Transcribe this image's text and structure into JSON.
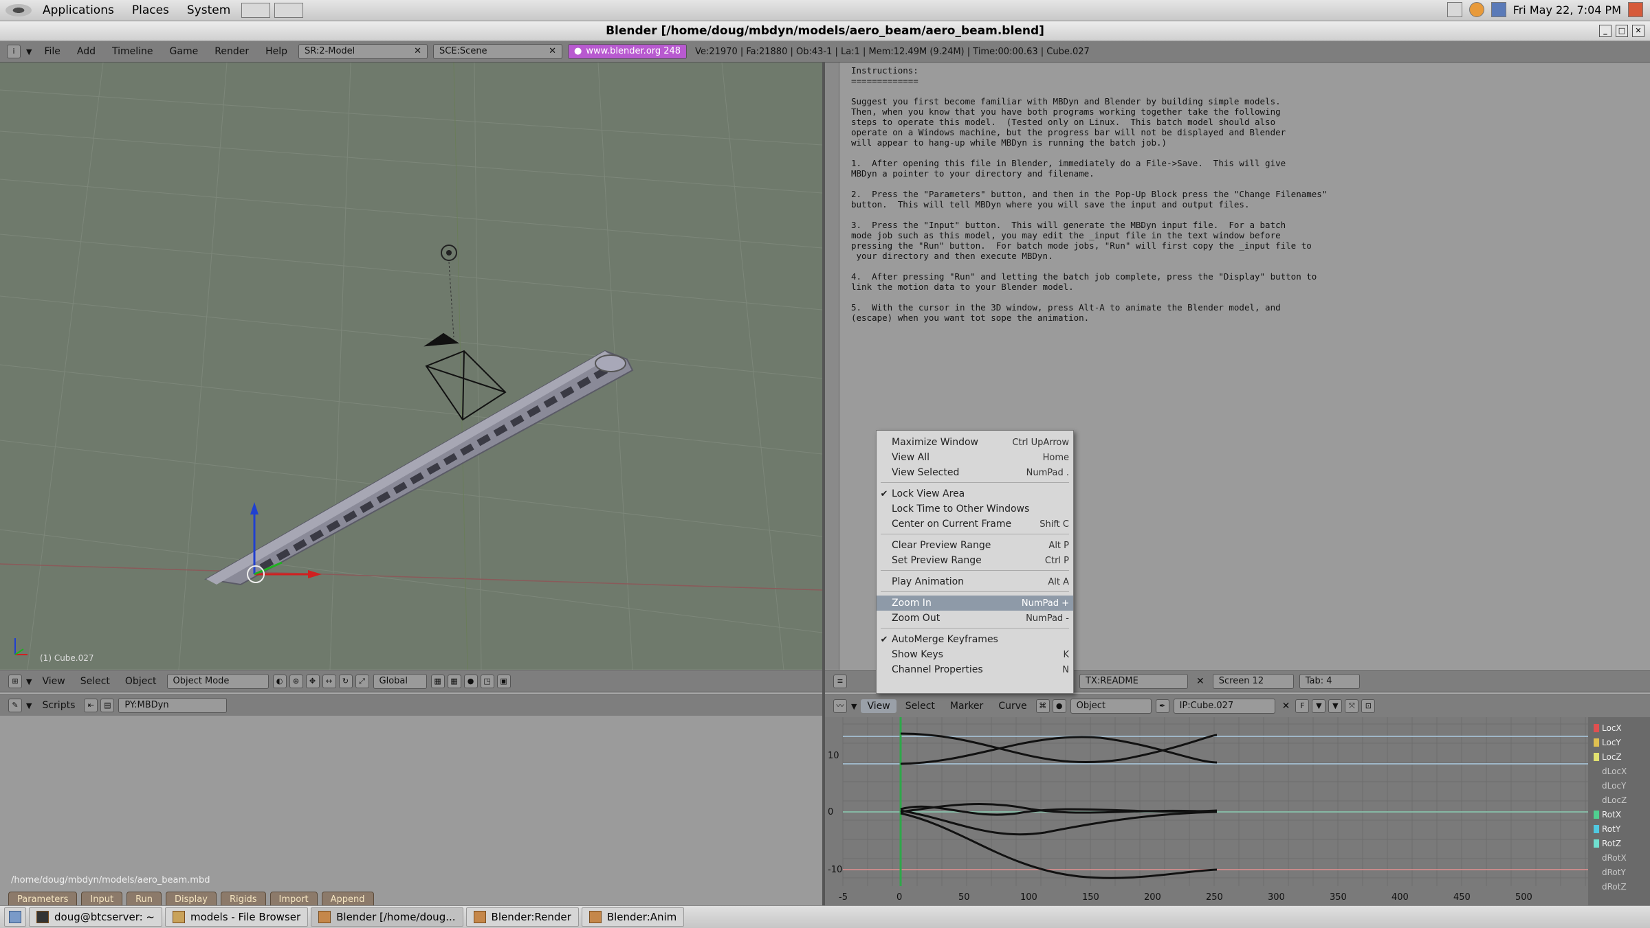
{
  "gnome_panel": {
    "menus": [
      "Applications",
      "Places",
      "System"
    ],
    "clock": "Fri May 22,  7:04 PM"
  },
  "window": {
    "title": "Blender [/home/doug/mbdyn/models/aero_beam/aero_beam.blend]"
  },
  "info_header": {
    "menus": [
      "File",
      "Add",
      "Timeline",
      "Game",
      "Render",
      "Help"
    ],
    "screen_field": "SR:2-Model",
    "scene_field": "SCE:Scene",
    "website": "www.blender.org 248",
    "stats": "Ve:21970 | Fa:21880 | Ob:43-1 | La:1  | Mem:12.49M (9.24M)  | Time:00:00.63 | Cube.027"
  },
  "viewport": {
    "caption": "(1) Cube.027",
    "header": {
      "menus": [
        "View",
        "Select",
        "Object"
      ],
      "mode": "Object Mode",
      "orientation": "Global"
    }
  },
  "text_editor": {
    "lines": [
      "Instructions:",
      "=============",
      "",
      "Suggest you first become familiar with MBDyn and Blender by building simple models.",
      "Then, when you know that you have both programs working together take the following",
      "steps to operate this model.  (Tested only on Linux.  This batch model should also",
      "operate on a Windows machine, but the progress bar will not be displayed and Blender",
      "will appear to hang-up while MBDyn is running the batch job.)",
      "",
      "1.  After opening this file in Blender, immediately do a File->Save.  This will give",
      "MBDyn a pointer to your directory and filename.",
      "",
      "2.  Press the \"Parameters\" button, and then in the Pop-Up Block press the \"Change Filenames\"",
      "button.  This will tell MBDyn where you will save the input and output files.",
      "",
      "3.  Press the \"Input\" button.  This will generate the MBDyn input file.  For a batch",
      "mode job such as this model, you may edit the _input file in the text window before",
      "pressing the \"Run\" button.  For batch mode jobs, \"Run\" will first copy the _input file to",
      " your directory and then execute MBDyn.",
      "",
      "4.  After pressing \"Run\" and letting the batch job complete, press the \"Display\" button to",
      "link the motion data to your Blender model.",
      "",
      "5.  With the cursor in the 3D window, press Alt-A to animate the Blender model, and",
      "(escape) when you want tot sope the animation."
    ],
    "header": {
      "text_name": "TX:README",
      "screen": "Screen 12",
      "tab": "Tab: 4"
    }
  },
  "scripts": {
    "header_label": "Scripts",
    "script_name": "PY:MBDyn",
    "path": "/home/doug/mbdyn/models/aero_beam.mbd",
    "buttons": [
      "Parameters",
      "Input",
      "Run",
      "Display",
      "Rigids",
      "Import",
      "Append"
    ]
  },
  "ipo": {
    "header": {
      "menus": [
        "View",
        "Select",
        "Marker",
        "Curve"
      ],
      "ob_type": "Object",
      "ipo_name": "IP:Cube.027"
    },
    "channels": [
      "LocX",
      "LocY",
      "LocZ",
      "dLocX",
      "dLocY",
      "dLocZ",
      "RotX",
      "RotY",
      "RotZ",
      "dRotX",
      "dRotY",
      "dRotZ"
    ],
    "x_ticks": [
      "0",
      "50",
      "100",
      "150",
      "200",
      "250",
      "300",
      "350",
      "400",
      "450",
      "500"
    ],
    "y_ticks": [
      "10",
      "0",
      "-10"
    ],
    "x_label_left": "-5"
  },
  "context_menu": {
    "items": [
      {
        "label": "Maximize Window",
        "shortcut": "Ctrl UpArrow",
        "checked": false
      },
      {
        "label": "View All",
        "shortcut": "Home",
        "checked": false
      },
      {
        "label": "View Selected",
        "shortcut": "NumPad .",
        "checked": false
      },
      {
        "label": "Lock View Area",
        "shortcut": "",
        "checked": true
      },
      {
        "label": "Lock Time to Other Windows",
        "shortcut": "",
        "checked": false
      },
      {
        "label": "Center on Current Frame",
        "shortcut": "Shift C",
        "checked": false
      },
      {
        "label": "Clear Preview Range",
        "shortcut": "Alt P",
        "checked": false
      },
      {
        "label": "Set Preview Range",
        "shortcut": "Ctrl P",
        "checked": false
      },
      {
        "label": "Play Animation",
        "shortcut": "Alt A",
        "checked": false
      },
      {
        "label": "Zoom In",
        "shortcut": "NumPad +",
        "checked": false,
        "highlighted": true
      },
      {
        "label": "Zoom Out",
        "shortcut": "NumPad -",
        "checked": false
      },
      {
        "label": "AutoMerge Keyframes",
        "shortcut": "",
        "checked": true
      },
      {
        "label": "Show Keys",
        "shortcut": "K",
        "checked": false
      },
      {
        "label": "Channel Properties",
        "shortcut": "N",
        "checked": false
      }
    ]
  },
  "taskbar": {
    "items": [
      "doug@btcserver: ~",
      "models - File Browser",
      "Blender [/home/doug...",
      "Blender:Render",
      "Blender:Anim"
    ]
  },
  "colors": {
    "viewport_bg": "#6f7a6c",
    "panel_bg": "#7e7e7e",
    "menu_highlight": "#8e9aa8",
    "website_field": "#b85ad0",
    "script_button": "#8c7a6a"
  }
}
